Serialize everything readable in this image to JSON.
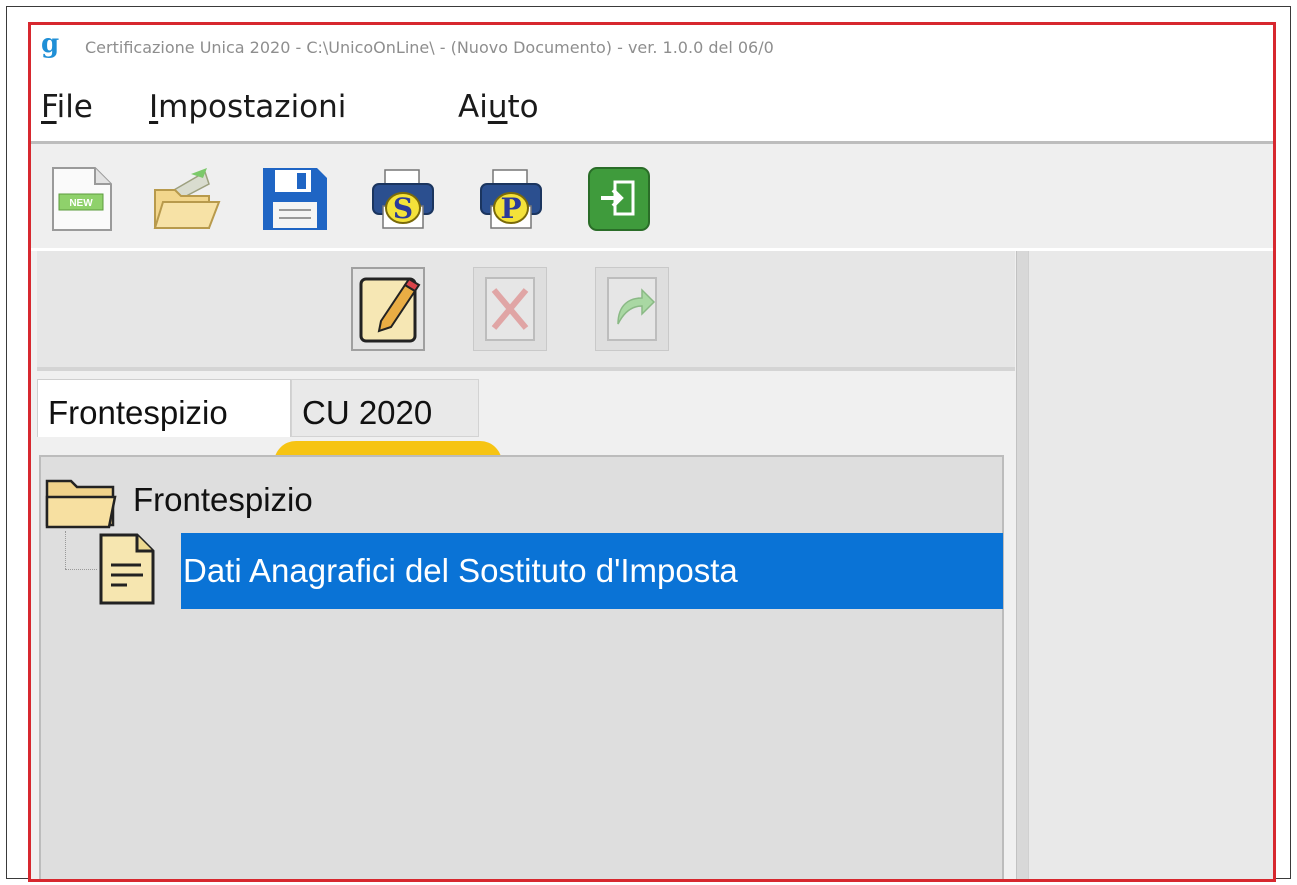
{
  "window": {
    "app_logo": "g",
    "title": "Certificazione Unica 2020 - C:\\UnicoOnLine\\ - (Nuovo Documento)  -  ver. 1.0.0 del 06/0"
  },
  "menu": {
    "file": {
      "accel": "F",
      "rest": "ile"
    },
    "impostazioni": {
      "accel": "I",
      "rest": "mpostazioni"
    },
    "aiuto": {
      "pre": "Ai",
      "accel": "u",
      "rest": "to"
    }
  },
  "toolbar": {
    "new_icon_label": "NEW",
    "print_s_label": "S",
    "print_p_label": "P"
  },
  "tabs": [
    {
      "label": "Frontespizio",
      "selected": true
    },
    {
      "label": "CU 2020",
      "selected": false
    }
  ],
  "tree": {
    "root_label": "Frontespizio",
    "child_label": "Dati Anagrafici del Sostituto d'Imposta"
  },
  "colors": {
    "frame_border": "#d7282f",
    "selection": "#0a73d6",
    "highlight": "#f6c000",
    "app_logo": "#1f8fd6"
  },
  "icons": [
    "new-document-icon",
    "open-folder-icon",
    "save-icon",
    "print-s-icon",
    "print-p-icon",
    "exit-icon",
    "edit-icon",
    "delete-icon",
    "export-icon",
    "folder-icon",
    "document-icon"
  ]
}
